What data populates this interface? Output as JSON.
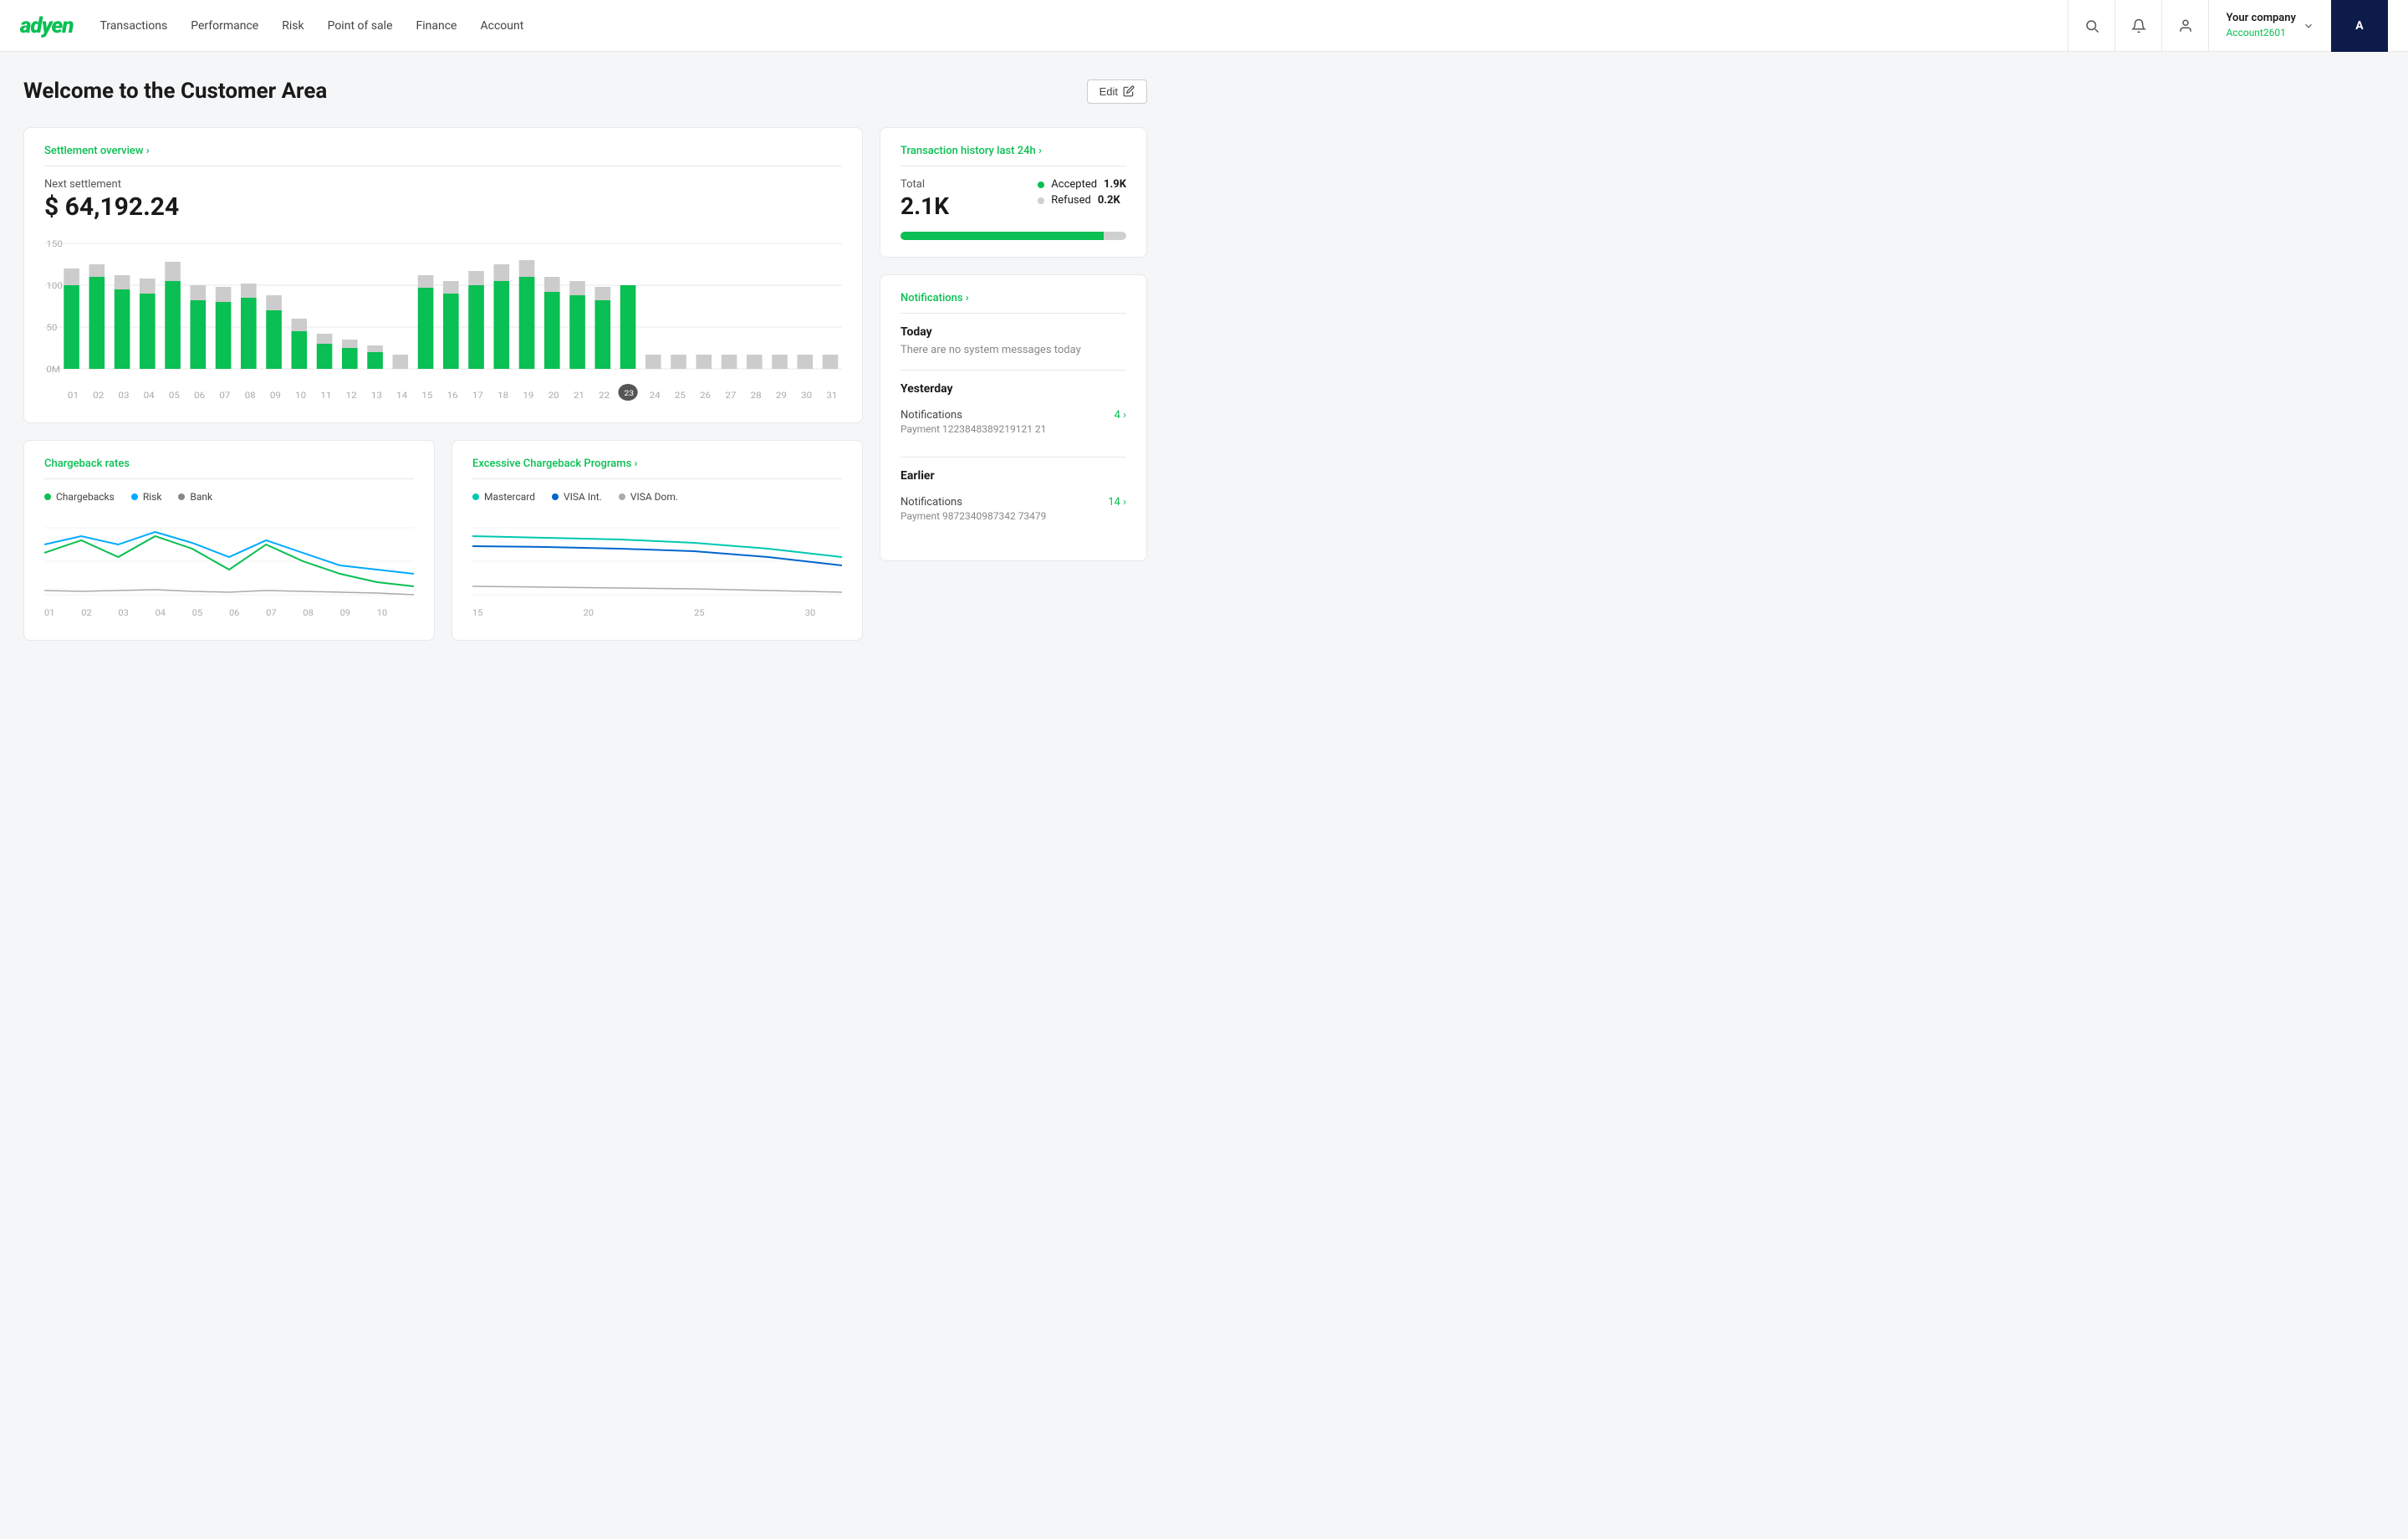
{
  "nav": {
    "logo": "adyen",
    "links": [
      "Transactions",
      "Performance",
      "Risk",
      "Point of sale",
      "Finance",
      "Account"
    ],
    "company": "Your company",
    "account_id": "Account2601",
    "avatar_initials": "A"
  },
  "header": {
    "title": "Welcome to the Customer Area",
    "edit_label": "Edit"
  },
  "settlement": {
    "card_title": "Settlement overview ›",
    "next_label": "Next settlement",
    "amount": "$ 64,192.24",
    "y_labels": [
      "150",
      "100",
      "50",
      "0M"
    ],
    "x_labels": [
      "01",
      "02",
      "03",
      "04",
      "05",
      "06",
      "07",
      "08",
      "09",
      "10",
      "11",
      "12",
      "13",
      "14",
      "15",
      "16",
      "17",
      "18",
      "19",
      "20",
      "21",
      "22",
      "23",
      "24",
      "25",
      "26",
      "27",
      "28",
      "29",
      "30",
      "31"
    ],
    "current_day": "23"
  },
  "transaction_history": {
    "card_title": "Transaction history last 24h ›",
    "total_label": "Total",
    "total_value": "2.1K",
    "accepted_label": "Accepted",
    "accepted_value": "1.9K",
    "refused_label": "Refused",
    "refused_value": "0.2K",
    "accepted_pct": 90,
    "refused_pct": 10
  },
  "notifications": {
    "card_title": "Notifications ›",
    "today_label": "Today",
    "today_empty": "There are no system messages today",
    "yesterday_label": "Yesterday",
    "yesterday_notif_label": "Notifications",
    "yesterday_notif_count": "4 ›",
    "yesterday_payment_label": "Payment 1223848389219121 21",
    "earlier_label": "Earlier",
    "earlier_notif_label": "Notifications",
    "earlier_notif_count": "14 ›",
    "earlier_payment_label": "Payment 9872340987342 73479"
  },
  "chargeback": {
    "card_title": "Chargeback rates",
    "legend": [
      {
        "label": "Chargebacks",
        "color": "#0abf53"
      },
      {
        "label": "Risk",
        "color": "#00aaff"
      },
      {
        "label": "Bank",
        "color": "#888"
      }
    ],
    "x_labels": [
      "01",
      "02",
      "03",
      "04",
      "05",
      "06",
      "07",
      "08",
      "09",
      "10"
    ]
  },
  "excessive_chargeback": {
    "card_title": "Excessive Chargeback Programs ›",
    "legend": [
      {
        "label": "Mastercard",
        "color": "#00c8b0"
      },
      {
        "label": "VISA Int.",
        "color": "#0066cc"
      },
      {
        "label": "VISA Dom.",
        "color": "#aaa"
      }
    ],
    "x_labels": [
      "15",
      "20",
      "25",
      "30"
    ]
  }
}
